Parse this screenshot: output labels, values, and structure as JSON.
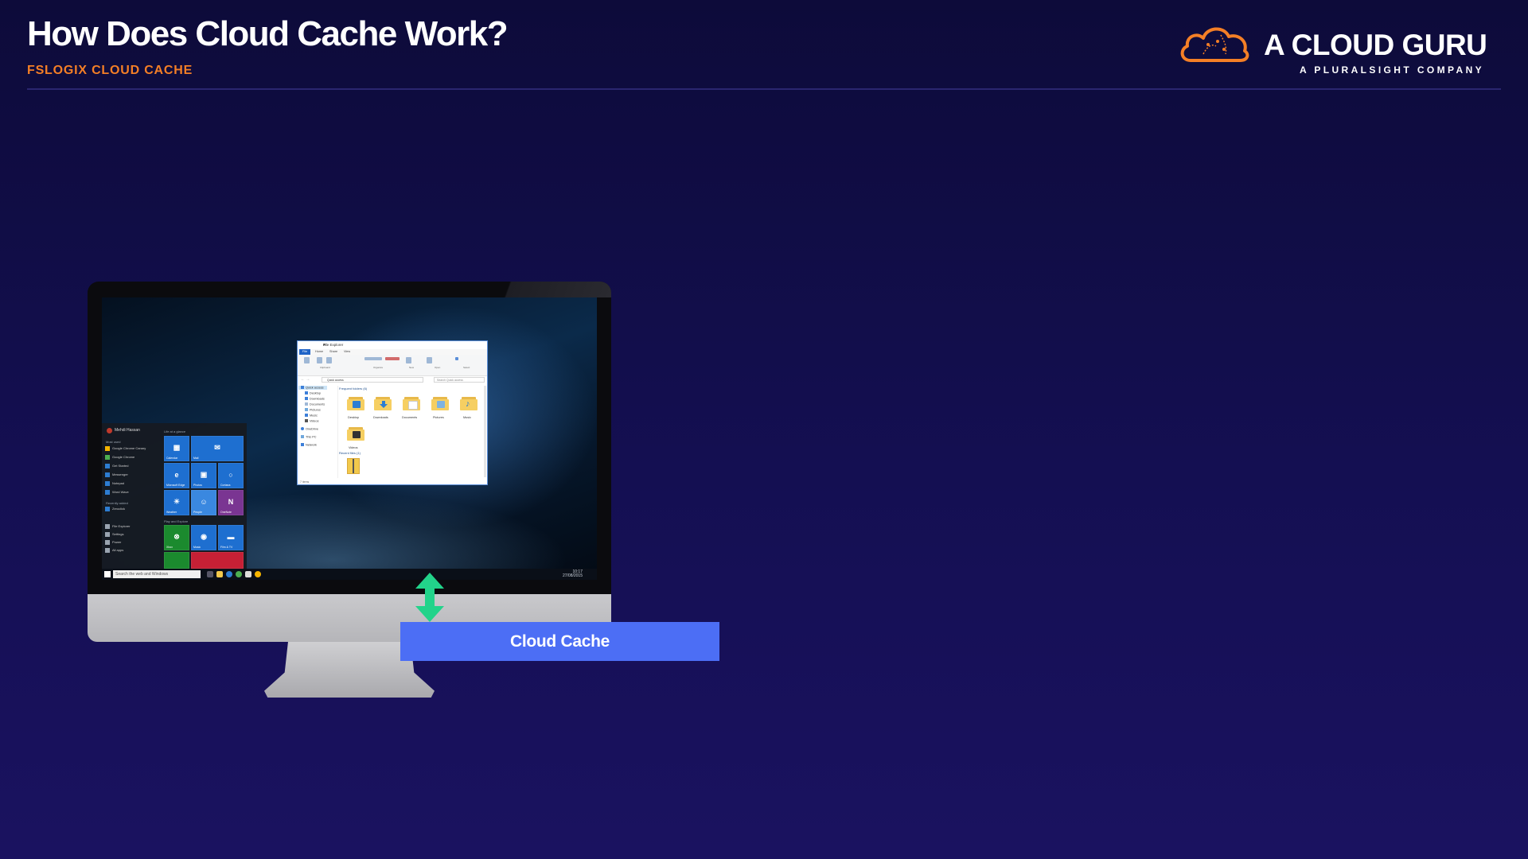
{
  "slide": {
    "title": "How Does Cloud Cache Work?",
    "subtitle": "FSLOGIX CLOUD CACHE"
  },
  "logo": {
    "name": "A CLOUD GURU",
    "tagline": "A PLURALSIGHT COMPANY",
    "accent": "#f47f26"
  },
  "diagram": {
    "cloud_cache_label": "Cloud Cache",
    "label_color": "#4c6ef5",
    "arrow_color": "#22d38a",
    "arrow_icon": "double-vertical-arrow-icon"
  },
  "desktop": {
    "taskbar": {
      "search_placeholder": "Search the web and Windows",
      "time": "10:17",
      "date": "27/08/2015"
    },
    "start_menu": {
      "user": "Mehdi Hassan",
      "most_used_heading": "Most used",
      "most_used": [
        "Google Chrome Canary",
        "Google Chrome",
        "Get Started",
        "Messenger",
        "Notepad",
        "Word Wave"
      ],
      "recently_added_heading": "Recently added",
      "recently_added": [
        "Zeroclick"
      ],
      "system": [
        "File Explorer",
        "Settings",
        "Power",
        "All apps"
      ],
      "life_heading": "Life at a glance",
      "play_heading": "Play and Explore",
      "tiles": [
        "Calendar",
        "Mail",
        "Microsoft Edge",
        "Photos",
        "Cortana",
        "Weather",
        "People",
        "OneNote",
        "Xbox",
        "Music",
        "Film & TV"
      ]
    },
    "explorer": {
      "title": "File Explorer",
      "tabs": [
        "File",
        "Home",
        "Share",
        "View"
      ],
      "ribbon_groups": [
        "Clipboard",
        "Organize",
        "New",
        "Open",
        "Select"
      ],
      "ribbon_items": [
        "Pin to Quick access",
        "Copy",
        "Paste",
        "Cut",
        "Copy path",
        "Paste shortcut",
        "Move to",
        "Copy to",
        "Delete",
        "Rename",
        "New folder",
        "Properties",
        "Open",
        "Edit",
        "History",
        "Select all",
        "Select none",
        "Invert selection"
      ],
      "address": "Quick access",
      "search_placeholder": "Search Quick access",
      "nav": [
        "Quick access",
        "Desktop",
        "Downloads",
        "Documents",
        "Pictures",
        "Music",
        "Videos",
        "OneDrive",
        "This PC",
        "Network"
      ],
      "frequent_heading": "Frequent folders (6)",
      "folders": [
        "Desktop",
        "Downloads",
        "Documents",
        "Pictures",
        "Music",
        "Videos"
      ],
      "recent_heading": "Recent files (1)",
      "status": "7 items"
    }
  }
}
